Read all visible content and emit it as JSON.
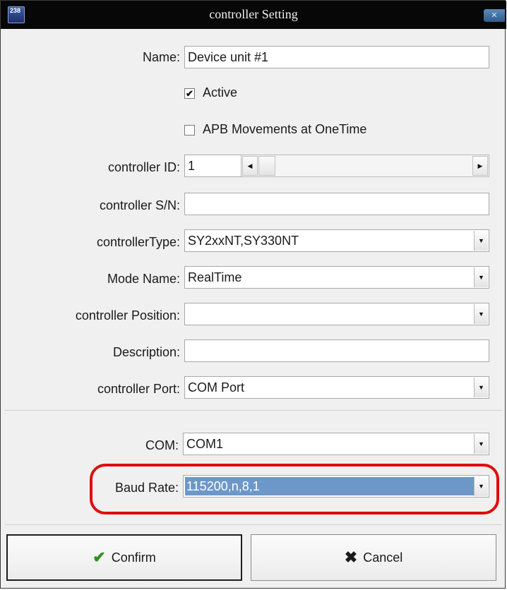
{
  "window": {
    "title": "controller Setting",
    "app_icon_text": "238",
    "close_glyph": "✕"
  },
  "form": {
    "name": {
      "label": "Name:",
      "value": "Device unit #1"
    },
    "active": {
      "label": "Active",
      "checked": true,
      "glyph": "✔"
    },
    "apb": {
      "label": "APB Movements at OneTime",
      "checked": false,
      "glyph": ""
    },
    "controller_id": {
      "label": "controller ID:",
      "value": "1",
      "scroll_left": "◀",
      "scroll_right": "▶"
    },
    "controller_sn": {
      "label": "controller S/N:",
      "value": ""
    },
    "controller_type": {
      "label": "controllerType:",
      "value": "SY2xxNT,SY330NT"
    },
    "mode_name": {
      "label": "Mode Name:",
      "value": "RealTime"
    },
    "controller_position": {
      "label": "controller Position:",
      "value": ""
    },
    "description": {
      "label": "Description:",
      "value": ""
    },
    "controller_port": {
      "label": "controller Port:",
      "value": "COM Port"
    },
    "com": {
      "label": "COM:",
      "value": "COM1"
    },
    "baud_rate": {
      "label": "Baud Rate:",
      "value": "115200,n,8,1"
    },
    "dropdown_glyph": "▼"
  },
  "buttons": {
    "confirm": {
      "label": "Confirm",
      "icon_glyph": "✔"
    },
    "cancel": {
      "label": "Cancel",
      "icon_glyph": "✖"
    }
  },
  "colors": {
    "titlebar": "#070707",
    "selection": "#6d97c8",
    "highlight_ring": "#e10c0c",
    "confirm_icon": "#2f8f1f"
  }
}
